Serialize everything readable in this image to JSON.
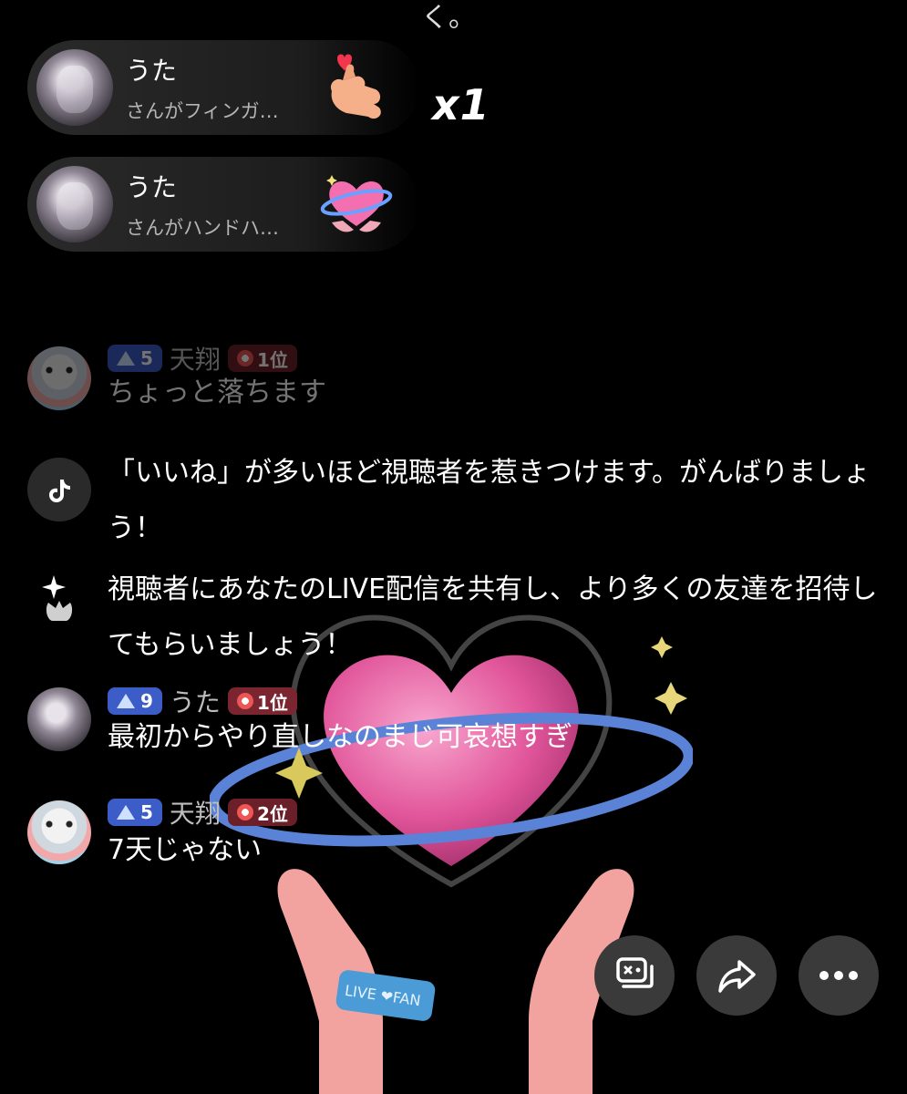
{
  "top_fragment": "く。",
  "gifts": [
    {
      "name": "うた",
      "desc": "さんがフィンガ…",
      "gift_icon": "finger-heart-icon"
    },
    {
      "name": "うた",
      "desc": "さんがハンドハ…",
      "gift_icon": "hand-heart-icon"
    }
  ],
  "combo": "x1",
  "chat": [
    {
      "avatar": "seal-avatar",
      "level": "5",
      "username": "天翔",
      "rank": "1位",
      "text": "ちょっと落ちます"
    },
    {
      "avatar": "tiktok-icon",
      "text": "「いいね」が多いほど視聴者を惹きつけます。がんばりましょう！"
    },
    {
      "avatar": "sparkle-icon",
      "text": "視聴者にあなたのLIVE配信を共有し、より多くの友達を招待してもらいましょう！"
    },
    {
      "avatar": "uta-avatar",
      "level": "9",
      "username": "うた",
      "rank": "1位",
      "text": "最初からやり直しなのまじ可哀想すぎ"
    },
    {
      "avatar": "seal-avatar",
      "level": "5",
      "username": "天翔",
      "rank": "2位",
      "text": "7天じゃない"
    }
  ],
  "wristband_text": "LIVE ❤FAN",
  "buttons": [
    "chat-toggle-icon",
    "share-icon",
    "more-icon"
  ],
  "colors": {
    "background": "#000000",
    "level_badge": "#3c5cc8",
    "rank_badge": "#6b1f28",
    "heart": "#f06aa8"
  }
}
